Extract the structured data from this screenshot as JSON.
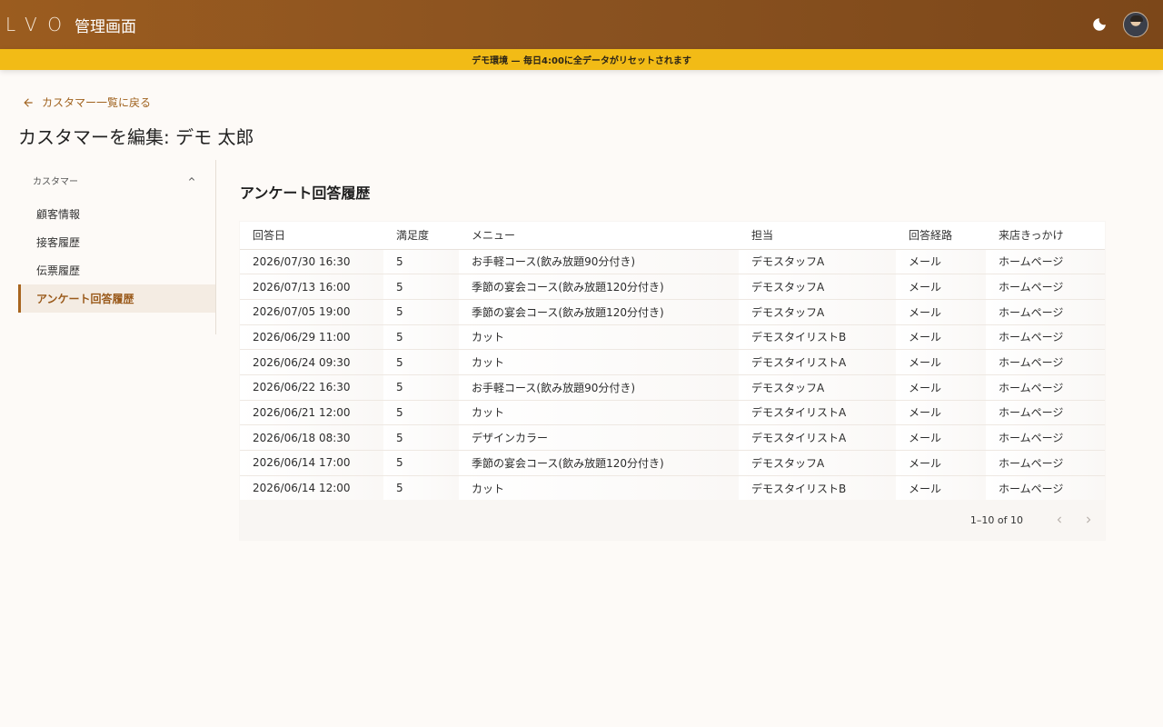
{
  "appbar": {
    "logo": "LVO",
    "title": "管理画面"
  },
  "banner": {
    "text": "デモ環境 — 毎日4:00に全データがリセットされます"
  },
  "breadcrumb": {
    "back_label": "カスタマー一覧に戻る"
  },
  "page": {
    "title": "カスタマーを編集: デモ 太郎"
  },
  "sidebar": {
    "group_label": "カスタマー",
    "items": [
      {
        "label": "顧客情報"
      },
      {
        "label": "接客履歴"
      },
      {
        "label": "伝票履歴"
      },
      {
        "label": "アンケート回答履歴"
      }
    ]
  },
  "section": {
    "title": "アンケート回答履歴"
  },
  "table": {
    "columns": [
      "回答日",
      "満足度",
      "メニュー",
      "担当",
      "回答経路",
      "来店きっかけ"
    ],
    "rows": [
      [
        "2026/07/30 16:30",
        "5",
        "お手軽コース(飲み放題90分付き)",
        "デモスタッフA",
        "メール",
        "ホームページ"
      ],
      [
        "2026/07/13 16:00",
        "5",
        "季節の宴会コース(飲み放題120分付き)",
        "デモスタッフA",
        "メール",
        "ホームページ"
      ],
      [
        "2026/07/05 19:00",
        "5",
        "季節の宴会コース(飲み放題120分付き)",
        "デモスタッフA",
        "メール",
        "ホームページ"
      ],
      [
        "2026/06/29 11:00",
        "5",
        "カット",
        "デモスタイリストB",
        "メール",
        "ホームページ"
      ],
      [
        "2026/06/24 09:30",
        "5",
        "カット",
        "デモスタイリストA",
        "メール",
        "ホームページ"
      ],
      [
        "2026/06/22 16:30",
        "5",
        "お手軽コース(飲み放題90分付き)",
        "デモスタッフA",
        "メール",
        "ホームページ"
      ],
      [
        "2026/06/21 12:00",
        "5",
        "カット",
        "デモスタイリストA",
        "メール",
        "ホームページ"
      ],
      [
        "2026/06/18 08:30",
        "5",
        "デザインカラー",
        "デモスタイリストA",
        "メール",
        "ホームページ"
      ],
      [
        "2026/06/14 17:00",
        "5",
        "季節の宴会コース(飲み放題120分付き)",
        "デモスタッフA",
        "メール",
        "ホームページ"
      ],
      [
        "2026/06/14 12:00",
        "5",
        "カット",
        "デモスタイリストB",
        "メール",
        "ホームページ"
      ]
    ]
  },
  "pagination": {
    "label": "1–10 of 10"
  },
  "colors": {
    "appbar": "#8a5220",
    "banner": "#f2bb16",
    "accent": "#a0621e"
  },
  "icons": {
    "theme_toggle": "moon-icon",
    "back": "arrow-left-icon",
    "collapse": "chevron-up-icon",
    "prev": "chevron-left-icon",
    "next": "chevron-right-icon"
  }
}
